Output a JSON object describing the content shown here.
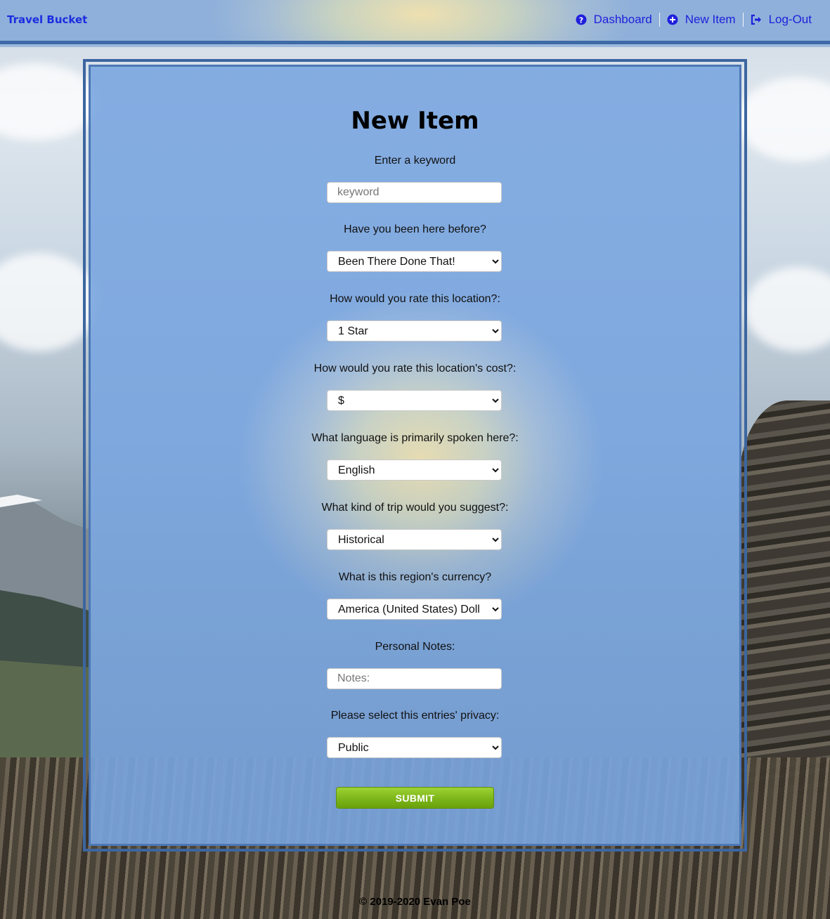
{
  "navbar": {
    "brand": "Travel Bucket",
    "links": [
      {
        "label": "Dashboard",
        "icon": "question-circle-icon"
      },
      {
        "label": "New Item",
        "icon": "plus-circle-icon"
      },
      {
        "label": "Log-Out",
        "icon": "sign-out-icon"
      }
    ]
  },
  "form": {
    "title": "New Item",
    "keyword": {
      "label": "Enter a keyword",
      "placeholder": "keyword",
      "value": ""
    },
    "visited": {
      "label": "Have you been here before?",
      "selected": "Been There Done That!"
    },
    "rating": {
      "label": "How would you rate this location?:",
      "selected": "1 Star"
    },
    "cost": {
      "label": "How would you rate this location's cost?:",
      "selected": "$"
    },
    "language": {
      "label": "What language is primarily spoken here?:",
      "selected": "English"
    },
    "trip_type": {
      "label": "What kind of trip would you suggest?:",
      "selected": "Historical"
    },
    "currency": {
      "label": "What is this region's currency?",
      "selected": "America (United States) Dollars"
    },
    "notes": {
      "label": "Personal Notes:",
      "placeholder": "Notes:",
      "value": ""
    },
    "privacy": {
      "label": "Please select this entries' privacy:",
      "selected": "Public"
    },
    "submit_label": "SUBMIT"
  },
  "footer": {
    "text": "© 2019-2020 Evan Poe"
  },
  "colors": {
    "link": "#1f1fdc",
    "panel_border": "#3c66a0",
    "submit": "#7fb81b"
  }
}
